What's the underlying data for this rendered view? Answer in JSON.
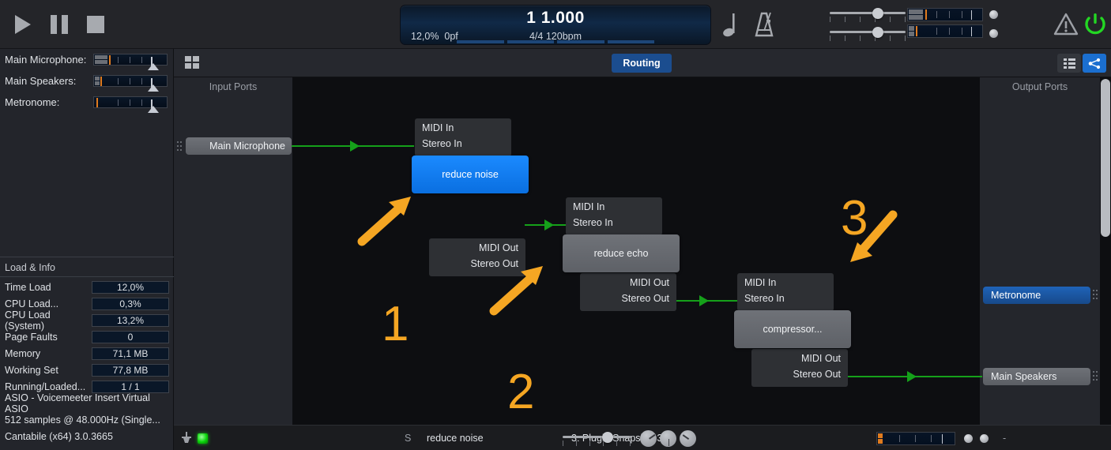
{
  "app": {
    "name": "Cantabile",
    "version_line": "Cantabile (x64) 3.0.3665"
  },
  "colors": {
    "accent_blue": "#1b6fd0",
    "selected_blue": "#0a6fe0",
    "wire_green": "#15a01a",
    "annotation_orange": "#f5a623",
    "led_green": "#0ad30a",
    "meter_orange": "#e07b1e"
  },
  "transport": {
    "play_label": "play",
    "pause_label": "pause",
    "stop_label": "stop",
    "icons": [
      "play-icon",
      "pause-icon",
      "stop-icon"
    ],
    "display": {
      "position": "1 1.000",
      "time_load": "12,0%",
      "page_faults": "0pf",
      "time_signature_tempo": "4/4 120bpm"
    },
    "note_icon": "quarter-note-icon",
    "metronome_icon": "metronome-icon",
    "warning_icon": "warning-triangle-icon",
    "power_icon": "power-icon"
  },
  "sidebar": {
    "mixer": [
      {
        "label": "Main Microphone:",
        "meter_name": "main-microphone-meter"
      },
      {
        "label": "Main Speakers:",
        "meter_name": "main-speakers-meter"
      },
      {
        "label": "Metronome:",
        "meter_name": "metronome-meter"
      }
    ],
    "load_info": {
      "title": "Load & Info",
      "rows": [
        {
          "label": "Time Load",
          "value": "12,0%"
        },
        {
          "label": "CPU Load...",
          "value": "0,3%"
        },
        {
          "label": "CPU Load (System)",
          "value": "13,2%"
        },
        {
          "label": "Page Faults",
          "value": "0"
        },
        {
          "label": "Memory",
          "value": "71,1 MB"
        },
        {
          "label": "Working Set",
          "value": "77,8 MB"
        },
        {
          "label": "Running/Loaded...",
          "value": "1 / 1"
        }
      ],
      "lines": [
        "ASIO - Voicemeeter Insert Virtual ASIO",
        "512 samples @ 48.000Hz (Single...",
        "Cantabile (x64) 3.0.3665"
      ]
    }
  },
  "routing_toolbar": {
    "grid_icon": "grid-icon",
    "tab_label": "Routing",
    "list_view_icon": "list-view-icon",
    "graph_view_icon": "routing-graph-icon"
  },
  "canvas": {
    "input_ports_title": "Input Ports",
    "output_ports_title": "Output Ports",
    "input_ports": [
      {
        "label": "Main Microphone",
        "state": "normal"
      }
    ],
    "output_ports": [
      {
        "label": "Metronome",
        "state": "selected"
      },
      {
        "label": "Main Speakers",
        "state": "normal"
      }
    ],
    "io_labels": {
      "midi_in": "MIDI In",
      "stereo_in": "Stereo In",
      "midi_out": "MIDI Out",
      "stereo_out": "Stereo Out"
    },
    "plugins": [
      {
        "name": "reduce noise",
        "state": "selected"
      },
      {
        "name": "reduce echo",
        "state": "normal"
      },
      {
        "name": "compressor...",
        "state": "normal"
      }
    ],
    "annotations": [
      {
        "number": "1",
        "direction": "up-right"
      },
      {
        "number": "2",
        "direction": "up-right"
      },
      {
        "number": "3",
        "direction": "down-left"
      }
    ]
  },
  "bottom_bar": {
    "plug_icon": "plug-icon",
    "led_name": "active-led",
    "solo_label": "S",
    "plugin_name": "reduce noise",
    "snapshot_label": "3: Plugin Snapshot 3",
    "dash_label": "-"
  }
}
